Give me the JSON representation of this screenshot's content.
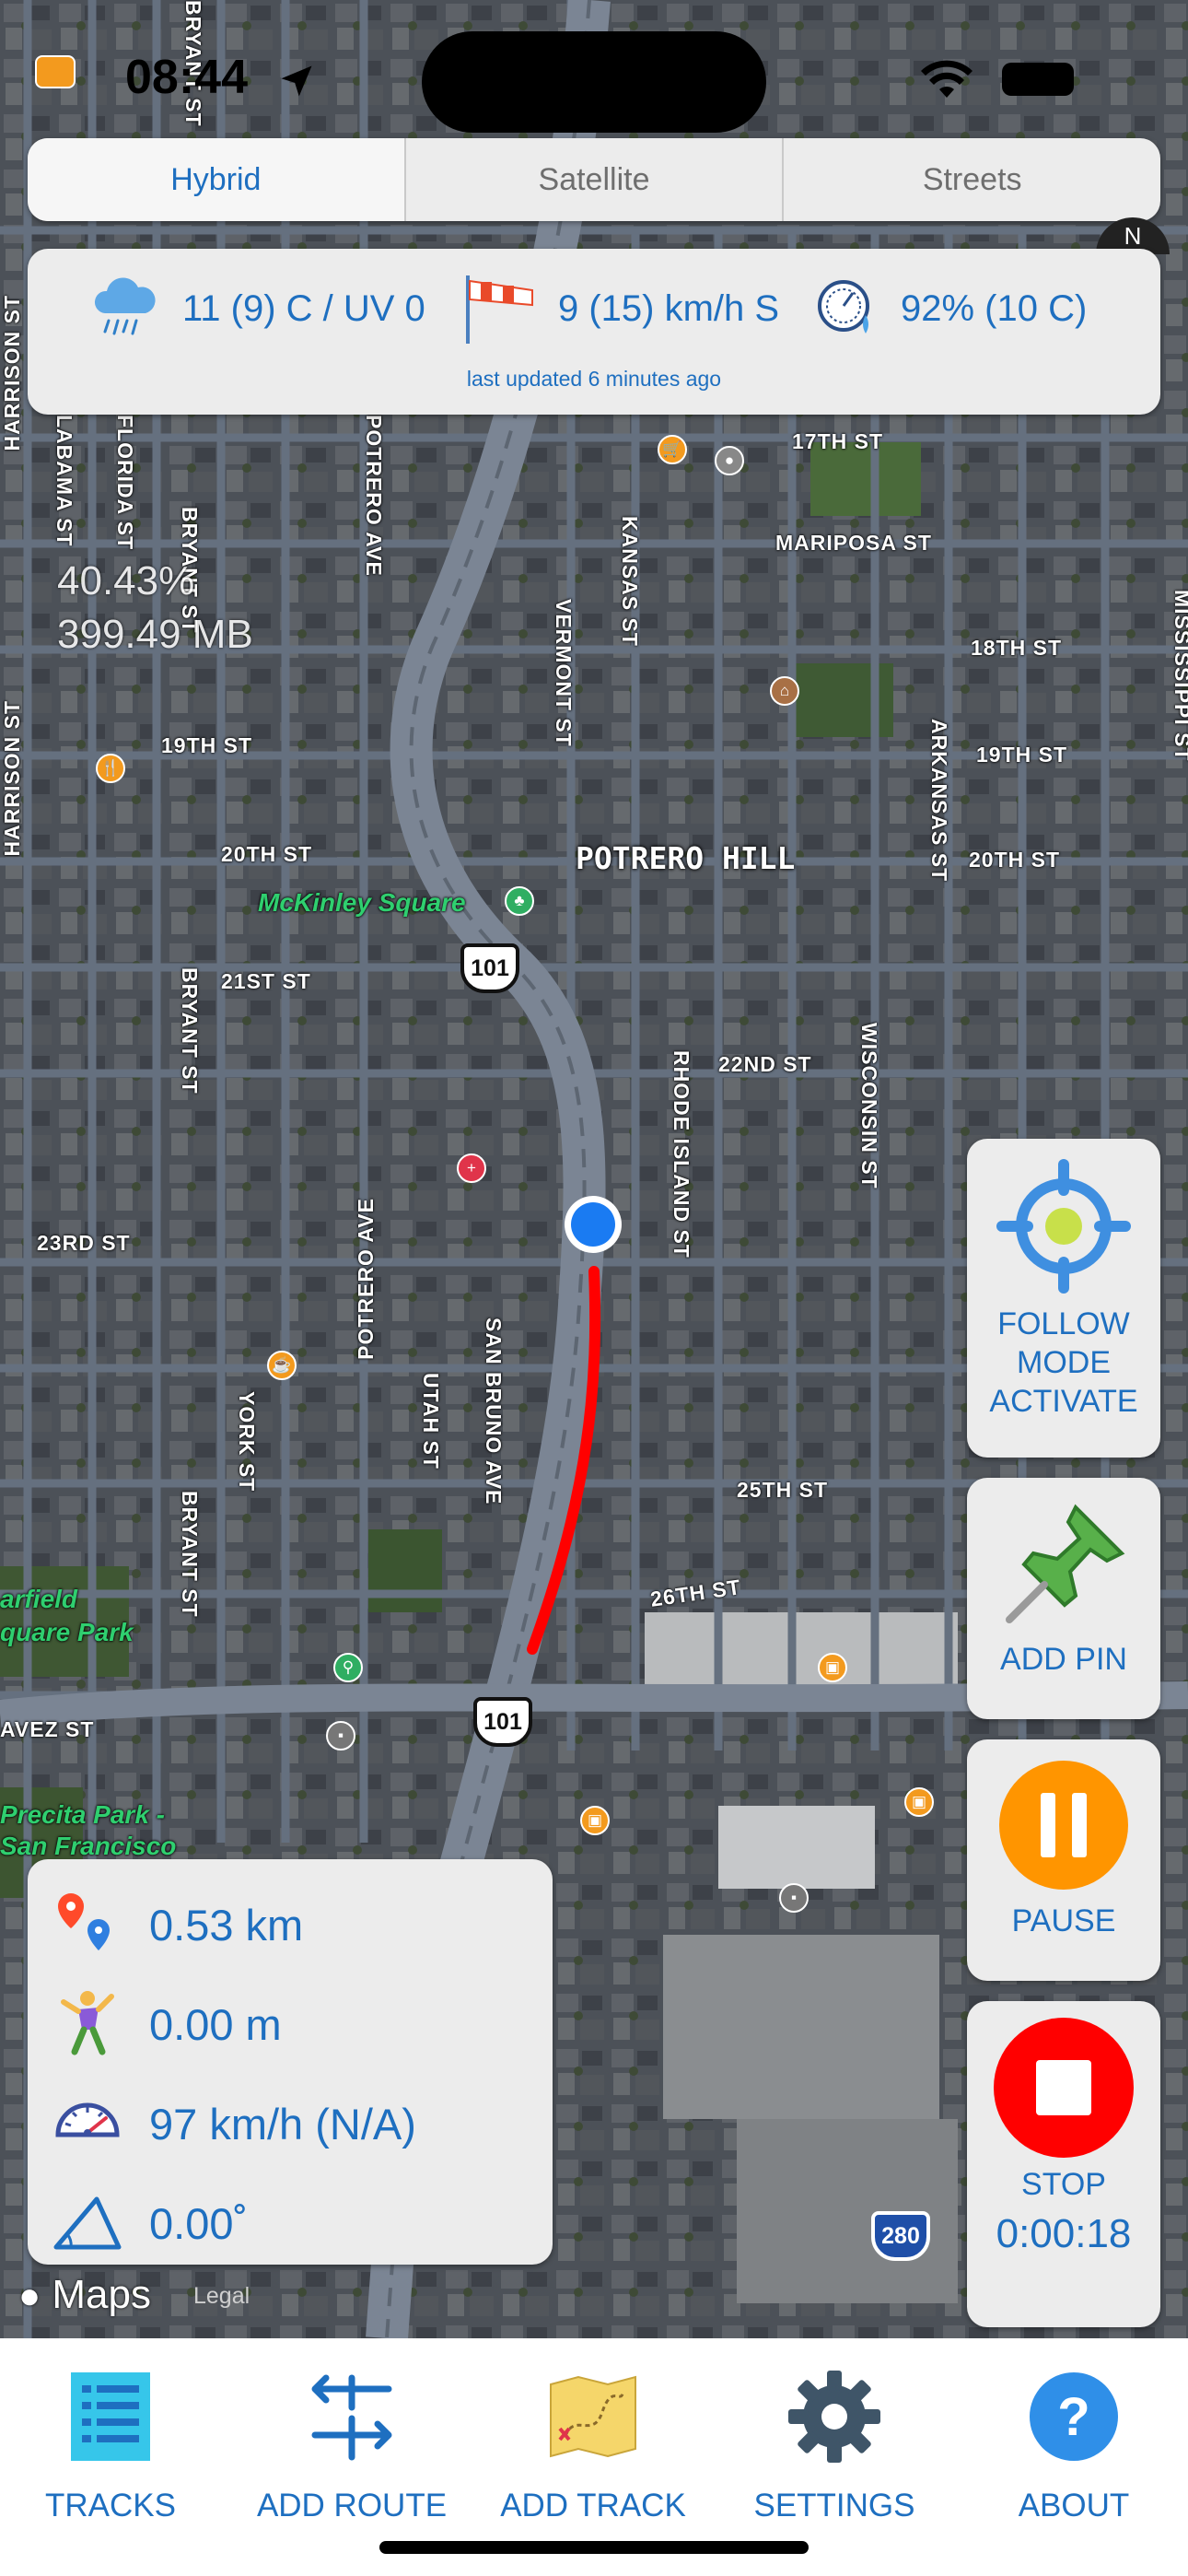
{
  "status_bar": {
    "time": "08:44"
  },
  "map_mode": {
    "options": [
      "Hybrid",
      "Satellite",
      "Streets"
    ],
    "selected": "Hybrid"
  },
  "weather": {
    "temperature": "11 (9) C / UV 0",
    "wind": "9 (15) km/h S",
    "humidity": "92% (10 C)",
    "updated": "last updated 6 minutes ago"
  },
  "map_overlay": {
    "percent": "40.43%",
    "size": "399.49 MB"
  },
  "map_labels": {
    "neighborhood": "POTRERO HILL",
    "park_mckinley": "McKinley Square",
    "park_garfield_1": "arfield",
    "park_garfield_2": "quare Park",
    "park_precita_1": "Precita Park -",
    "park_precita_2": "San Francisco",
    "highway_101": "101",
    "highway_280": "280",
    "streets": {
      "st17": "17TH ST",
      "mariposa": "MARIPOSA ST",
      "st18": "18TH ST",
      "st19_left": "19TH ST",
      "st19_right": "19TH ST",
      "st20_left": "20TH ST",
      "st20_right": "20TH ST",
      "st21": "21ST ST",
      "st22": "22ND ST",
      "st23": "23RD ST",
      "st25": "25TH ST",
      "st26": "26TH ST",
      "cesar": "AVEZ ST",
      "harrison_top": "HARRISON ST",
      "alabama": "LABAMA ST",
      "florida": "FLORIDA ST",
      "bryant_top": "BRYANT ST",
      "potrero_top": "POTRERO AVE",
      "vermont": "VERMONT ST",
      "kansas": "KANSAS ST",
      "harrison_mid": "HARRISON ST",
      "arkansas": "ARKANSAS ST",
      "rhode_island": "RHODE ISLAND ST",
      "wisconsin": "WISCONSIN ST",
      "bryant_mid": "BRYANT ST",
      "potrero_bottom": "POTRERO AVE",
      "york": "YORK ST",
      "utah": "UTAH ST",
      "san_bruno": "SAN BRUNO AVE",
      "bryant_bottom": "BRYANT ST",
      "mississippi": "MISSISSIPPI ST",
      "bryant_upper": "BRYANT ST"
    }
  },
  "side_buttons": {
    "follow": "FOLLOW MODE ACTIVATE",
    "add_pin": "ADD PIN",
    "pause": "PAUSE",
    "stop": "STOP",
    "elapsed": "0:00:18"
  },
  "stats": {
    "distance": "0.53 km",
    "elevation": "0.00 m",
    "speed": "97 km/h (N/A)",
    "slope": "0.00˚"
  },
  "attribution": {
    "maps": "Maps",
    "legal": "Legal"
  },
  "tabs": {
    "tracks": "TRACKS",
    "add_route": "ADD ROUTE",
    "add_track": "ADD TRACK",
    "settings": "SETTINGS",
    "about": "ABOUT"
  },
  "colors": {
    "accent": "#1e6fc0",
    "track": "#ff0000",
    "pause": "#ff9500",
    "stop": "#ff0000"
  },
  "icons": [
    "navigation-arrow-icon",
    "wifi-icon",
    "battery-icon",
    "rain-cloud-icon",
    "windsock-icon",
    "hygrometer-icon",
    "crosshair-icon",
    "pushpin-icon",
    "pause-icon",
    "stop-icon",
    "distance-pins-icon",
    "climber-icon",
    "speedometer-icon",
    "slope-icon",
    "list-icon",
    "arrows-icon",
    "treasure-map-icon",
    "gear-icon",
    "question-icon",
    "apple-icon"
  ]
}
